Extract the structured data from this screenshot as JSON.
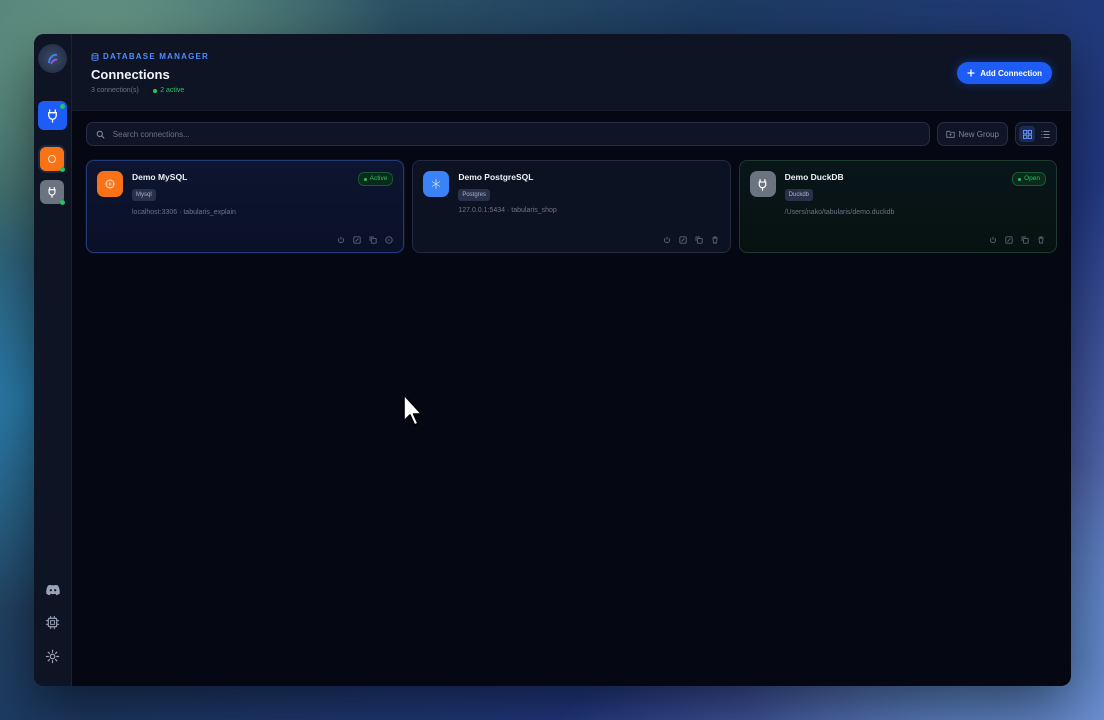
{
  "header": {
    "eyebrow": "DATABASE MANAGER",
    "title": "Connections",
    "count_text": "3 connection(s)",
    "active_text": "2 active",
    "add_label": "Add Connection"
  },
  "toolbar": {
    "search_placeholder": "Search connections...",
    "new_group_label": "New Group"
  },
  "connections": [
    {
      "name": "Demo MySQL",
      "engine": "Mysql",
      "host": "localhost:3306 · tabularis_explain",
      "status": "Active",
      "color": "#f97316"
    },
    {
      "name": "Demo PostgreSQL",
      "engine": "Postgres",
      "host": "127.0.0.1:5434 · tabularis_shop",
      "status": "",
      "color": "#3b82f6"
    },
    {
      "name": "Demo DuckDB",
      "engine": "Duckdb",
      "host": "/Users/nako/tabularis/demo.duckdb",
      "status": "Open",
      "color": "#6b7280"
    }
  ],
  "colors": {
    "accent": "#1d5cf5",
    "success": "#22c55e",
    "background": "#050713",
    "panel": "#0e1424"
  },
  "icons": {
    "rail": [
      "app-logo-icon",
      "plug-icon",
      "mysql-icon",
      "duckdb-plug-icon",
      "discord-icon",
      "cpu-icon",
      "gear-icon"
    ],
    "card_actions": [
      "power-icon",
      "edit-icon",
      "copy-icon",
      "delete-icon"
    ]
  }
}
